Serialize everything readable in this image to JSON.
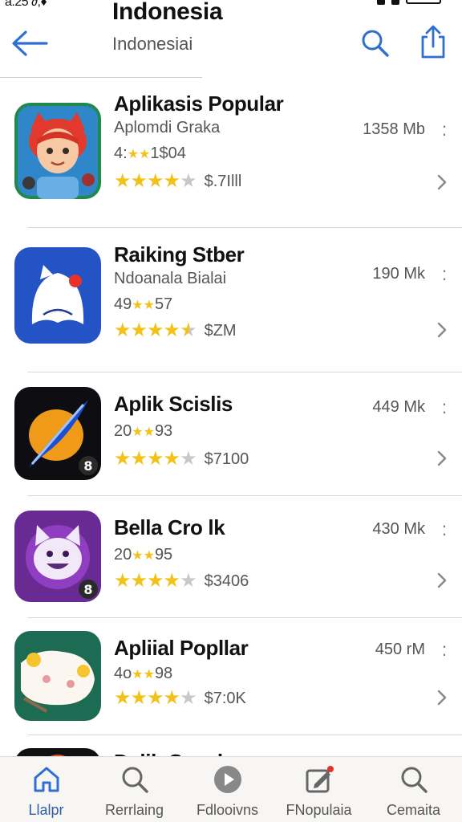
{
  "status_bar": {
    "time": "a.25 ∂,♦"
  },
  "nav": {
    "title": "Indonesia",
    "subtitle": "Indonesiai",
    "back_icon": "arrow-left-icon",
    "search_icon": "search-icon",
    "share_icon": "share-icon"
  },
  "colors": {
    "accent": "#2e6fd0",
    "star": "#f2c21b",
    "star_empty": "#c8c8c8",
    "tab_active": "#2e5fa8"
  },
  "apps": [
    {
      "name": "Aplikasis Popular",
      "subtitle": "Aplomdi Graka",
      "meta_pre": "4:",
      "meta_post": "1$04",
      "rating_stars": 4,
      "price": "$.7Illl",
      "size": "1358 Mb",
      "icon": "girl-character-icon"
    },
    {
      "name": "Raiking Stber",
      "subtitle": "Ndoanala Bialai",
      "meta_pre": "49",
      "meta_post": "57",
      "rating_stars": 4.5,
      "price": "$ZM",
      "size": "190 Mk",
      "icon": "ghost-icon"
    },
    {
      "name": "Aplik Scislis",
      "subtitle": "",
      "meta_pre": "20",
      "meta_post": "93",
      "rating_stars": 4,
      "price": "$7100",
      "size": "449 Mk",
      "icon": "feather-icon"
    },
    {
      "name": "Bella Cro lk",
      "subtitle": "",
      "meta_pre": "20",
      "meta_post": "95",
      "rating_stars": 4,
      "price": "$3406",
      "size": "430 Mk",
      "icon": "cat-character-icon"
    },
    {
      "name": "Apliial Popllar",
      "subtitle": "",
      "meta_pre": "4o",
      "meta_post": "98",
      "rating_stars": 4,
      "price": "$7:0K",
      "size": "450 rM",
      "icon": "pillow-character-icon"
    }
  ],
  "partial_row": {
    "name": "Dalib Scaula"
  },
  "tabs": [
    {
      "label": "Llalpr",
      "icon": "home-icon",
      "active": true
    },
    {
      "label": "Rerrlaing",
      "icon": "search-icon",
      "active": false
    },
    {
      "label": "Fdlooivns",
      "icon": "play-icon",
      "active": false
    },
    {
      "label": "FNopulaia",
      "icon": "edit-icon",
      "active": false
    },
    {
      "label": "Cemaita",
      "icon": "search-icon",
      "active": false
    }
  ]
}
